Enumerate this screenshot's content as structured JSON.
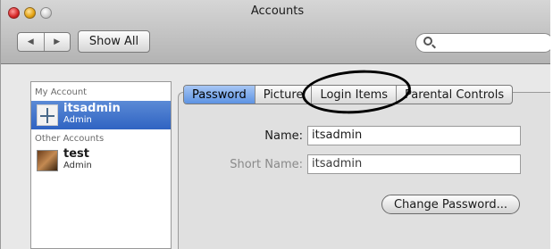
{
  "window": {
    "title": "Accounts"
  },
  "toolbar": {
    "back_glyph": "◀",
    "forward_glyph": "▶",
    "show_all_label": "Show All",
    "search_placeholder": ""
  },
  "sidebar": {
    "my_account_header": "My Account",
    "other_accounts_header": "Other Accounts",
    "accounts": [
      {
        "name": "itsadmin",
        "role": "Admin",
        "icon": "dragonfly-icon",
        "selected": true
      },
      {
        "name": "test",
        "role": "Admin",
        "icon": "dog-icon",
        "selected": false
      }
    ]
  },
  "tabs": [
    {
      "label": "Password",
      "active": true
    },
    {
      "label": "Picture",
      "active": false
    },
    {
      "label": "Login Items",
      "active": false
    },
    {
      "label": "Parental Controls",
      "active": false
    }
  ],
  "form": {
    "name_label": "Name:",
    "name_value": "itsadmin",
    "short_name_label": "Short Name:",
    "short_name_value": "itsadmin",
    "change_password_label": "Change Password..."
  },
  "colors": {
    "selection": "#2f63c2",
    "active_tab": "#5d93e3",
    "annotation": "#000000"
  }
}
